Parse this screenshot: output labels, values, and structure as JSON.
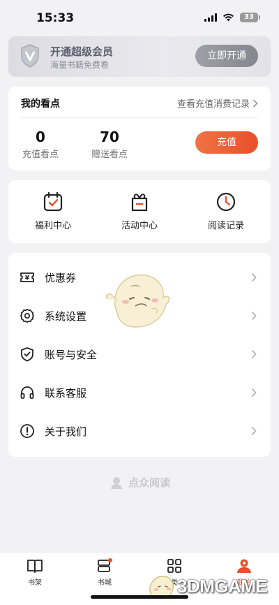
{
  "status_bar": {
    "time": "15:33",
    "battery": "33"
  },
  "vip": {
    "title": "开通超级会员",
    "subtitle": "海量书籍免费看",
    "button": "立即开通"
  },
  "points": {
    "title": "我的看点",
    "records_link": "查看充值消费记录",
    "recharged": {
      "value": "0",
      "label": "充值看点"
    },
    "gifted": {
      "value": "70",
      "label": "赠送看点"
    },
    "recharge_button": "充值"
  },
  "quick_actions": [
    {
      "label": "福利中心",
      "icon": "calendar-check-icon"
    },
    {
      "label": "活动中心",
      "icon": "gift-box-icon"
    },
    {
      "label": "阅读记录",
      "icon": "clock-icon"
    }
  ],
  "menu": [
    {
      "label": "优惠券",
      "icon": "coupon-icon"
    },
    {
      "label": "系统设置",
      "icon": "gear-icon"
    },
    {
      "label": "账号与安全",
      "icon": "shield-check-icon"
    },
    {
      "label": "联系客服",
      "icon": "headphones-icon"
    },
    {
      "label": "关于我们",
      "icon": "info-icon"
    }
  ],
  "brand": "点众阅读",
  "tabs": [
    {
      "label": "书架",
      "icon": "book-icon"
    },
    {
      "label": "书城",
      "icon": "store-icon"
    },
    {
      "label": "类",
      "icon": "grid-icon"
    },
    {
      "label": "我的",
      "icon": "profile-icon",
      "active": true
    }
  ],
  "watermark": "3DMGAME",
  "colors": {
    "accent": "#e8502a",
    "background": "#f2f2f4",
    "vip_button": "#8f9199"
  }
}
